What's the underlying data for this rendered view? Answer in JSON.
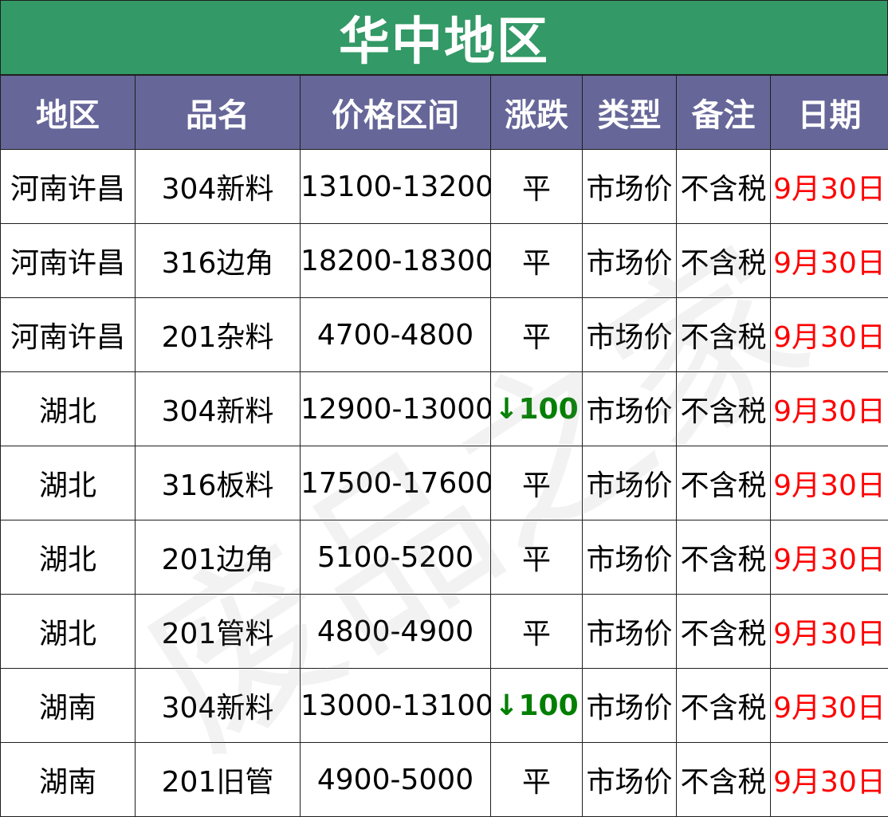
{
  "title": "华中地区",
  "headers": [
    "地区",
    "品名",
    "价格区间",
    "涨跌",
    "类型",
    "备注",
    "日期"
  ],
  "rows": [
    {
      "region": "河南许昌",
      "product": "304新料",
      "price": "13100-13200",
      "change": "平",
      "change_dir": "flat",
      "type": "市场价",
      "note": "不含税",
      "date": "9月30日"
    },
    {
      "region": "河南许昌",
      "product": "316边角",
      "price": "18200-18300",
      "change": "平",
      "change_dir": "flat",
      "type": "市场价",
      "note": "不含税",
      "date": "9月30日"
    },
    {
      "region": "河南许昌",
      "product": "201杂料",
      "price": "4700-4800",
      "change": "平",
      "change_dir": "flat",
      "type": "市场价",
      "note": "不含税",
      "date": "9月30日"
    },
    {
      "region": "湖北",
      "product": "304新料",
      "price": "12900-13000",
      "change": "↓100",
      "change_dir": "down",
      "type": "市场价",
      "note": "不含税",
      "date": "9月30日"
    },
    {
      "region": "湖北",
      "product": "316板料",
      "price": "17500-17600",
      "change": "平",
      "change_dir": "flat",
      "type": "市场价",
      "note": "不含税",
      "date": "9月30日"
    },
    {
      "region": "湖北",
      "product": "201边角",
      "price": "5100-5200",
      "change": "平",
      "change_dir": "flat",
      "type": "市场价",
      "note": "不含税",
      "date": "9月30日"
    },
    {
      "region": "湖北",
      "product": "201管料",
      "price": "4800-4900",
      "change": "平",
      "change_dir": "flat",
      "type": "市场价",
      "note": "不含税",
      "date": "9月30日"
    },
    {
      "region": "湖南",
      "product": "304新料",
      "price": "13000-13100",
      "change": "↓100",
      "change_dir": "down",
      "type": "市场价",
      "note": "不含税",
      "date": "9月30日"
    },
    {
      "region": "湖南",
      "product": "201旧管",
      "price": "4900-5000",
      "change": "平",
      "change_dir": "flat",
      "type": "市场价",
      "note": "不含税",
      "date": "9月30日"
    }
  ],
  "watermark": "废品之家",
  "colors": {
    "title_bg": "#339966",
    "header_bg": "#666699",
    "date_text": "#ff0000",
    "down_text": "#007f00"
  }
}
